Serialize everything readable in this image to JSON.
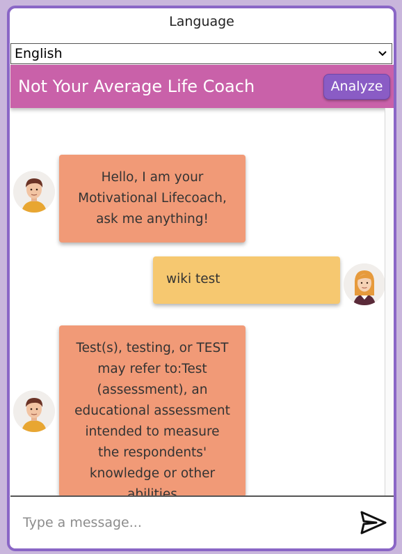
{
  "language": {
    "label": "Language",
    "selected": "English"
  },
  "header": {
    "title": "Not Your Average Life Coach",
    "analyze_label": "Analyze",
    "accent_color": "#c961a9",
    "button_color": "#8a5cc5"
  },
  "messages": [
    {
      "sender": "bot",
      "text": "Hello, I am your Motivational Lifecoach, ask me anything!",
      "avatar": "coach-avatar-icon"
    },
    {
      "sender": "user",
      "text": "wiki test",
      "avatar": "user-avatar-icon"
    },
    {
      "sender": "bot",
      "text": "Test(s), testing, or TEST may refer to:Test (assessment), an educational assessment intended to measure the respondents' knowledge or other abilities",
      "avatar": "coach-avatar-icon"
    }
  ],
  "composer": {
    "placeholder": "Type a message...",
    "send_icon": "send-icon"
  },
  "colors": {
    "bot_bubble": "#f19a77",
    "user_bubble": "#f6c870",
    "frame_border": "#8a66c6"
  }
}
